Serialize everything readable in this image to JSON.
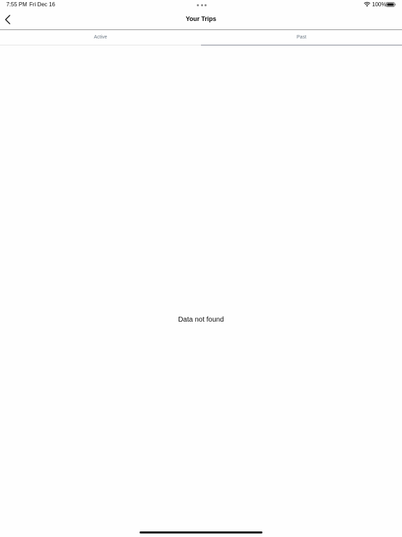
{
  "status_bar": {
    "time": "7:55 PM",
    "date": "Fri Dec 16",
    "battery": "100%",
    "icons": [
      "wifi-icon",
      "battery-icon"
    ]
  },
  "nav": {
    "title": "Your Trips",
    "back_icon": "chevron-left-icon"
  },
  "tabs": [
    {
      "label": "Active",
      "selected": false
    },
    {
      "label": "Past",
      "selected": true
    }
  ],
  "content": {
    "empty_message": "Data not found"
  },
  "colors": {
    "tab_text": "#6e7a86",
    "selected_underline": "#8b8f9a",
    "background": "#fefefe"
  }
}
